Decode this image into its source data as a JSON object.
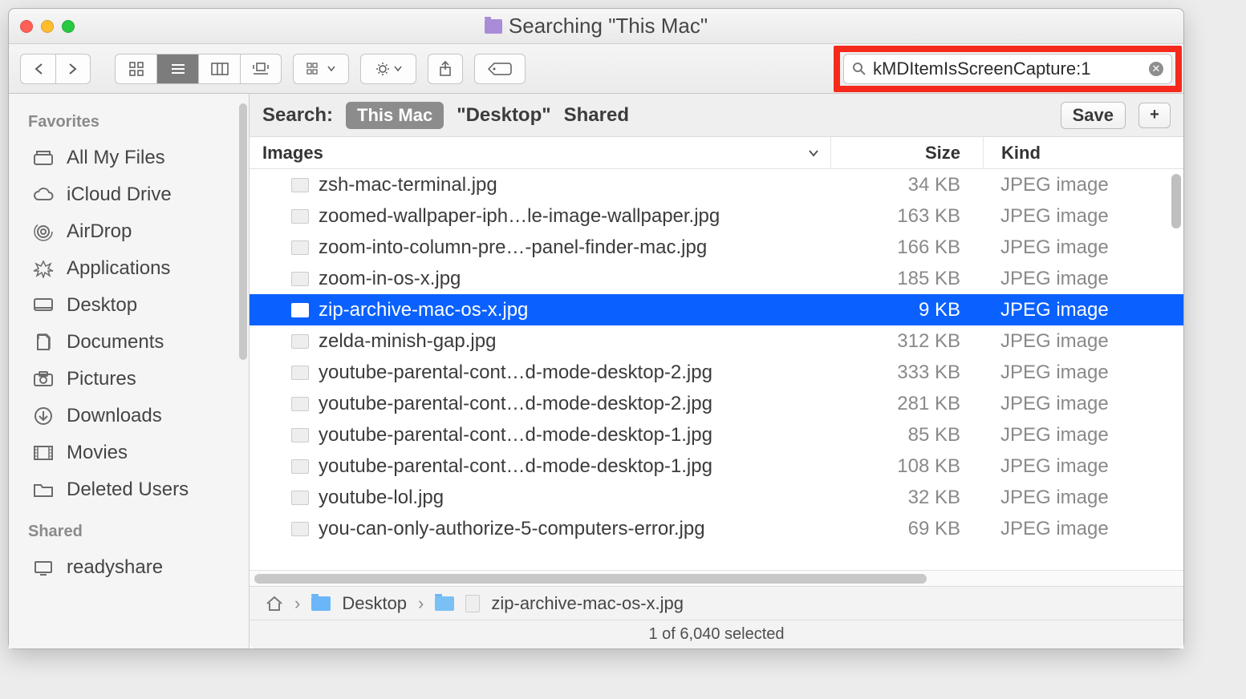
{
  "window_title": "Searching \"This Mac\"",
  "search_query": "kMDItemIsScreenCapture:1",
  "search_scope": {
    "label": "Search:",
    "active": "This Mac",
    "option2": "\"Desktop\"",
    "option3": "Shared",
    "save": "Save"
  },
  "sidebar": {
    "sections": {
      "favorites": "Favorites",
      "shared": "Shared"
    },
    "favorites": [
      {
        "label": "All My Files"
      },
      {
        "label": "iCloud Drive"
      },
      {
        "label": "AirDrop"
      },
      {
        "label": "Applications"
      },
      {
        "label": "Desktop"
      },
      {
        "label": "Documents"
      },
      {
        "label": "Pictures"
      },
      {
        "label": "Downloads"
      },
      {
        "label": "Movies"
      },
      {
        "label": "Deleted Users"
      }
    ],
    "shared": [
      {
        "label": "readyshare"
      }
    ]
  },
  "columns": {
    "name": "Images",
    "size": "Size",
    "kind": "Kind"
  },
  "files": [
    {
      "name": "zsh-mac-terminal.jpg",
      "size": "34 KB",
      "kind": "JPEG image",
      "selected": false
    },
    {
      "name": "zoomed-wallpaper-iph…le-image-wallpaper.jpg",
      "size": "163 KB",
      "kind": "JPEG image",
      "selected": false
    },
    {
      "name": "zoom-into-column-pre…-panel-finder-mac.jpg",
      "size": "166 KB",
      "kind": "JPEG image",
      "selected": false
    },
    {
      "name": "zoom-in-os-x.jpg",
      "size": "185 KB",
      "kind": "JPEG image",
      "selected": false
    },
    {
      "name": "zip-archive-mac-os-x.jpg",
      "size": "9 KB",
      "kind": "JPEG image",
      "selected": true
    },
    {
      "name": "zelda-minish-gap.jpg",
      "size": "312 KB",
      "kind": "JPEG image",
      "selected": false
    },
    {
      "name": "youtube-parental-cont…d-mode-desktop-2.jpg",
      "size": "333 KB",
      "kind": "JPEG image",
      "selected": false
    },
    {
      "name": "youtube-parental-cont…d-mode-desktop-2.jpg",
      "size": "281 KB",
      "kind": "JPEG image",
      "selected": false
    },
    {
      "name": "youtube-parental-cont…d-mode-desktop-1.jpg",
      "size": "85 KB",
      "kind": "JPEG image",
      "selected": false
    },
    {
      "name": "youtube-parental-cont…d-mode-desktop-1.jpg",
      "size": "108 KB",
      "kind": "JPEG image",
      "selected": false
    },
    {
      "name": "youtube-lol.jpg",
      "size": "32 KB",
      "kind": "JPEG image",
      "selected": false
    },
    {
      "name": "you-can-only-authorize-5-computers-error.jpg",
      "size": "69 KB",
      "kind": "JPEG image",
      "selected": false
    }
  ],
  "pathbar": {
    "folder": "Desktop",
    "file": "zip-archive-mac-os-x.jpg"
  },
  "status": "1 of 6,040 selected"
}
